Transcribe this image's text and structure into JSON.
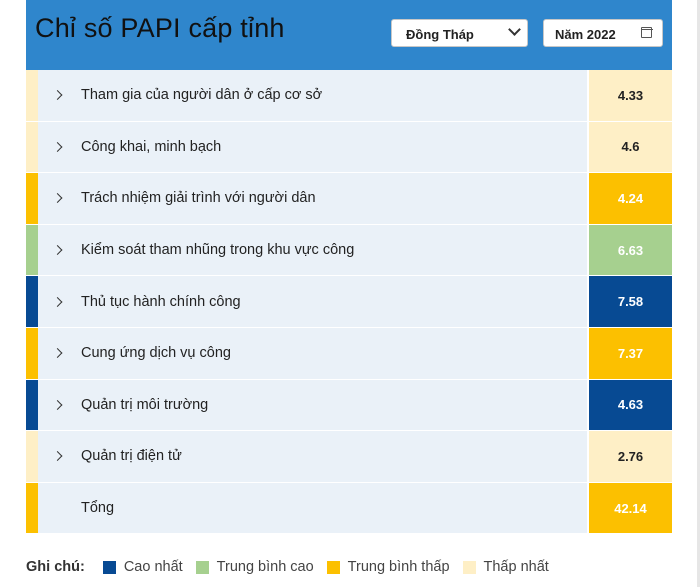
{
  "header": {
    "title": "Chỉ số PAPI cấp tỉnh",
    "province_select": "Đồng Tháp",
    "year_input": "Năm 2022",
    "background": "#2f86cc"
  },
  "colors": {
    "highest": "#074a93",
    "upper_middle": "#a6d08f",
    "lower_middle": "#fcc000",
    "lowest": "#feefc6"
  },
  "rows": [
    {
      "label": "Tham gia của người dân ở cấp cơ sở",
      "value": "4.33",
      "level": "lowest"
    },
    {
      "label": "Công khai, minh bạch",
      "value": "4.6",
      "level": "lowest"
    },
    {
      "label": "Trách nhiệm giải trình với người dân",
      "value": "4.24",
      "level": "lower_middle"
    },
    {
      "label": "Kiểm soát tham nhũng trong khu vực công",
      "value": "6.63",
      "level": "upper_middle"
    },
    {
      "label": "Thủ tục hành chính công",
      "value": "7.58",
      "level": "highest"
    },
    {
      "label": "Cung ứng dịch vụ công",
      "value": "7.37",
      "level": "lower_middle"
    },
    {
      "label": "Quản trị môi trường",
      "value": "4.63",
      "level": "highest"
    },
    {
      "label": "Quản trị điện tử",
      "value": "2.76",
      "level": "lowest"
    },
    {
      "label": "Tổng",
      "value": "42.14",
      "level": "lower_middle",
      "total": true
    }
  ],
  "legend": {
    "title": "Ghi chú:",
    "items": [
      {
        "label": "Cao nhất",
        "level": "highest"
      },
      {
        "label": "Trung bình cao",
        "level": "upper_middle"
      },
      {
        "label": "Trung bình thấp",
        "level": "lower_middle"
      },
      {
        "label": "Thấp nhất",
        "level": "lowest"
      }
    ]
  }
}
